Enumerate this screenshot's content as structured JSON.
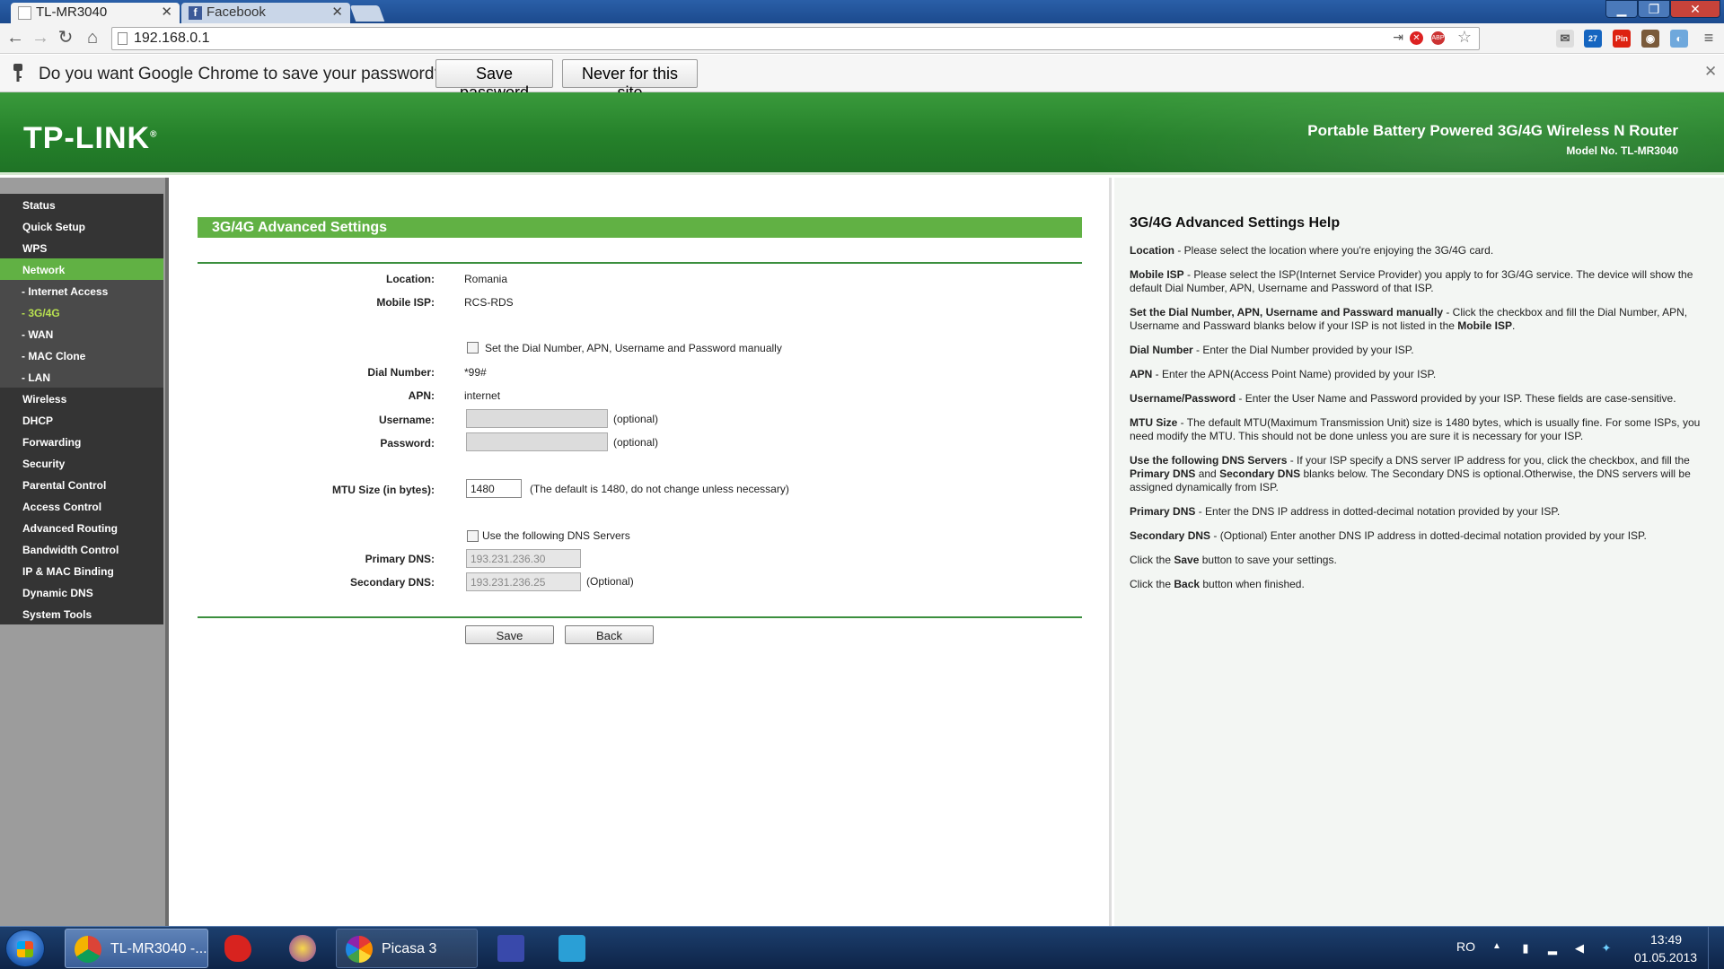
{
  "browser": {
    "tabs": [
      {
        "title": "TL-MR3040",
        "active": true
      },
      {
        "title": "Facebook",
        "active": false
      }
    ],
    "address": "192.168.0.1",
    "window_buttons": {
      "minimize": "▁",
      "maximize": "❐",
      "close": "✕"
    },
    "extensions": [
      "ABP",
      "Pin",
      "27"
    ]
  },
  "infobar": {
    "message": "Do you want Google Chrome to save your password?",
    "save_label": "Save password",
    "never_label": "Never for this site"
  },
  "banner": {
    "logo": "TP-LINK",
    "product": "Portable Battery Powered 3G/4G Wireless N Router",
    "model": "Model No. TL-MR3040"
  },
  "menu": [
    {
      "label": "Status",
      "type": "main"
    },
    {
      "label": "Quick Setup",
      "type": "main"
    },
    {
      "label": "WPS",
      "type": "main"
    },
    {
      "label": "Network",
      "type": "active"
    },
    {
      "label": "- Internet Access",
      "type": "sub"
    },
    {
      "label": "- 3G/4G",
      "type": "current"
    },
    {
      "label": "- WAN",
      "type": "sub"
    },
    {
      "label": "- MAC Clone",
      "type": "sub"
    },
    {
      "label": "- LAN",
      "type": "sub"
    },
    {
      "label": "Wireless",
      "type": "main"
    },
    {
      "label": "DHCP",
      "type": "main"
    },
    {
      "label": "Forwarding",
      "type": "main"
    },
    {
      "label": "Security",
      "type": "main"
    },
    {
      "label": "Parental Control",
      "type": "main"
    },
    {
      "label": "Access Control",
      "type": "main"
    },
    {
      "label": "Advanced Routing",
      "type": "main"
    },
    {
      "label": "Bandwidth Control",
      "type": "main"
    },
    {
      "label": "IP & MAC Binding",
      "type": "main"
    },
    {
      "label": "Dynamic DNS",
      "type": "main"
    },
    {
      "label": "System Tools",
      "type": "main"
    }
  ],
  "form": {
    "title": "3G/4G Advanced Settings",
    "location_label": "Location:",
    "location": "Romania",
    "isp_label": "Mobile ISP:",
    "isp": "RCS-RDS",
    "manual_label": "Set the Dial Number, APN, Username and Password manually",
    "manual_checked": false,
    "dial_label": "Dial Number:",
    "dial": "*99#",
    "apn_label": "APN:",
    "apn": "internet",
    "username_label": "Username:",
    "username": "",
    "password_label": "Password:",
    "password": "",
    "optional": "(optional)",
    "mtu_label": "MTU Size (in bytes):",
    "mtu": "1480",
    "mtu_hint": "(The default is 1480, do not change unless necessary)",
    "dns_label": "Use the following DNS Servers",
    "dns_checked": false,
    "primary_label": "Primary DNS:",
    "primary": "193.231.236.30",
    "secondary_label": "Secondary DNS:",
    "secondary": "193.231.236.25",
    "optional_cap": "(Optional)",
    "save_label": "Save",
    "back_label": "Back"
  },
  "help": {
    "title": "3G/4G Advanced Settings Help",
    "paragraphs": [
      [
        {
          "b": "Location"
        },
        {
          "t": " - Please select the location where you're enjoying the 3G/4G card."
        }
      ],
      [
        {
          "b": "Mobile ISP"
        },
        {
          "t": " - Please select the ISP(Internet Service Provider) you apply to for 3G/4G service. The device will show the default Dial Number, APN, Username and Password of that ISP."
        }
      ],
      [
        {
          "b": "Set the Dial Number, APN, Username and Passward manually"
        },
        {
          "t": " - Click the checkbox and fill the Dial Number, APN, Username and Passward blanks below if your ISP is not listed in the "
        },
        {
          "b": "Mobile ISP"
        },
        {
          "t": "."
        }
      ],
      [
        {
          "b": "Dial Number"
        },
        {
          "t": " - Enter the Dial Number provided by your ISP."
        }
      ],
      [
        {
          "b": "APN"
        },
        {
          "t": " - Enter the APN(Access Point Name) provided by your ISP."
        }
      ],
      [
        {
          "b": "Username/Password"
        },
        {
          "t": " - Enter the User Name and Password provided by your ISP. These fields are case-sensitive."
        }
      ],
      [
        {
          "b": "MTU Size"
        },
        {
          "t": " - The default MTU(Maximum Transmission Unit) size is 1480 bytes, which is usually fine. For some ISPs, you need modify the MTU. This should not be done unless you are sure it is necessary for your ISP."
        }
      ],
      [
        {
          "b": "Use the following DNS Servers"
        },
        {
          "t": " - If your ISP specify a DNS server IP address for you, click the checkbox, and fill the "
        },
        {
          "b": "Primary DNS"
        },
        {
          "t": " and "
        },
        {
          "b": "Secondary DNS"
        },
        {
          "t": " blanks below. The Secondary DNS is optional.Otherwise, the DNS servers will be assigned dynamically from ISP."
        }
      ],
      [
        {
          "b": "Primary DNS"
        },
        {
          "t": " - Enter the DNS IP address in dotted-decimal notation provided by your ISP."
        }
      ],
      [
        {
          "b": "Secondary DNS"
        },
        {
          "t": " - (Optional) Enter another DNS IP address in dotted-decimal notation provided by your ISP."
        }
      ],
      [
        {
          "t": "Click the "
        },
        {
          "b": "Save"
        },
        {
          "t": " button to save your settings."
        }
      ],
      [
        {
          "t": "Click the "
        },
        {
          "b": "Back"
        },
        {
          "t": " button when finished."
        }
      ]
    ]
  },
  "taskbar": {
    "chrome_label": "TL-MR3040 -...",
    "picasa_label": "Picasa 3",
    "lang": "RO",
    "time": "13:49",
    "date": "01.05.2013"
  },
  "colors": {
    "brand_green": "#61b144",
    "menu_dark": "#343434",
    "banner_green": "#25812a"
  }
}
